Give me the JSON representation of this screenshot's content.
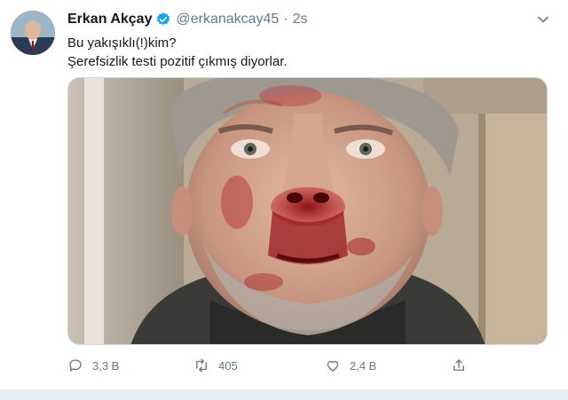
{
  "author": {
    "name": "Erkan Akçay",
    "handle": "@erkanakcay45",
    "separator": "·",
    "time": "2s"
  },
  "tweet": {
    "line1": "Bu yakışıklı(!)kim?",
    "line2": "Şerefsizlik testi pozitif çıkmış diyorlar."
  },
  "actions": {
    "reply_count": "3,3 B",
    "retweet_count": "405",
    "like_count": "2,4 B"
  },
  "icons": {
    "verified": "verified-badge-icon",
    "menu": "chevron-down-icon",
    "reply": "reply-icon",
    "retweet": "retweet-icon",
    "like": "heart-icon",
    "share": "share-icon"
  },
  "colors": {
    "accent": "#1da1f2",
    "muted": "#657786",
    "text": "#14171a",
    "border": "#ccd6dd"
  }
}
